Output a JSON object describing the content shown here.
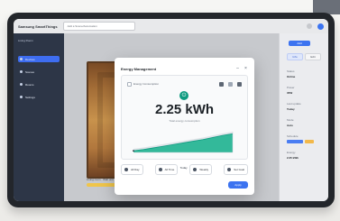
{
  "app": {
    "title": "Samsung SmartThings",
    "dropdown_placeholder": "Add a Scene/Automation",
    "workspace_label": "Living Room"
  },
  "sidebar": {
    "items": [
      {
        "label": "Devices"
      },
      {
        "label": "Scenes"
      },
      {
        "label": "Rooms"
      },
      {
        "label": "Settings"
      }
    ]
  },
  "main": {
    "photo_caption": "Living room · Wall unit",
    "tag": "Active"
  },
  "right_sidebar": {
    "top_button": "Add",
    "tabs": [
      {
        "label": "Info"
      },
      {
        "label": "Edit"
      }
    ],
    "rows": [
      {
        "k": "Status",
        "v": "Online"
      },
      {
        "k": "Power",
        "v": "35W"
      },
      {
        "k": "Last update",
        "v": "Today"
      },
      {
        "k": "Mode",
        "v": "Auto"
      },
      {
        "k": "Schedule",
        "v": "On"
      },
      {
        "k": "Energy",
        "v": "2.25 kWh"
      }
    ]
  },
  "modal": {
    "title": "Energy Management",
    "card_label": "Energy Consumption",
    "energy_value": "2.25 kWh",
    "energy_sub": "Total energy consumption",
    "stepper_value": "Today",
    "actions": [
      {
        "label": "All Day"
      },
      {
        "label": "All Time"
      },
      {
        "label": "Weekly"
      },
      {
        "label": "Set Goal"
      }
    ],
    "apply_label": "Apply"
  },
  "chart_data": {
    "type": "area",
    "x": [
      0,
      1,
      2,
      3,
      4,
      5,
      6,
      7,
      8,
      9,
      10
    ],
    "series": [
      {
        "values": [
          0.2,
          0.35,
          0.55,
          0.75,
          0.95,
          1.15,
          1.35,
          1.55,
          1.8,
          2.05,
          2.25
        ]
      },
      {
        "values": [
          0.1,
          0.12,
          0.14,
          0.15,
          0.17,
          0.18,
          0.2,
          0.22,
          0.24,
          0.26,
          0.28
        ]
      }
    ],
    "ylim": [
      0,
      2.5
    ],
    "title": "",
    "xlabel": "",
    "ylabel": ""
  },
  "colors": {
    "accent": "#3c73f0",
    "energy": "#0f9b80",
    "chart_fill": "#33b99a",
    "chart_ghost": "#dfe3e8"
  }
}
